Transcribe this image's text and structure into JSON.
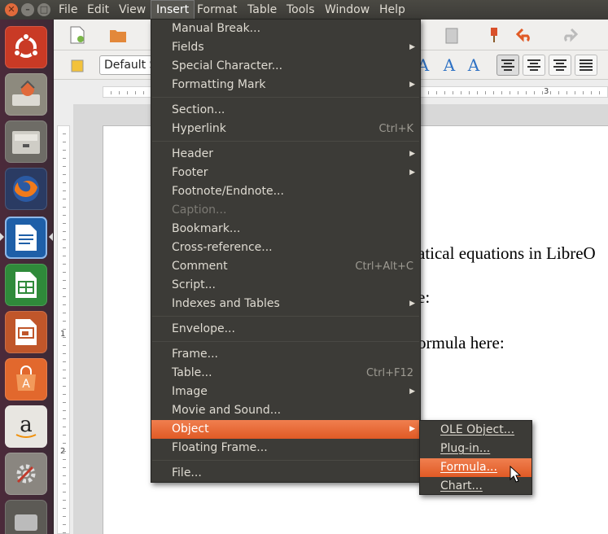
{
  "window_buttons": {
    "close": "✕",
    "minimize": "–",
    "maximize": "□"
  },
  "menubar": [
    "File",
    "Edit",
    "View",
    "Insert",
    "Format",
    "Table",
    "Tools",
    "Window",
    "Help"
  ],
  "style_box": "Default Style",
  "ruler": {
    "mark_h": "3",
    "mark_v1": "1",
    "mark_v2": "2"
  },
  "document": {
    "line1": "atical equations in LibreO",
    "line2": "e:",
    "line3": "ormula here:"
  },
  "insert_menu": {
    "items": [
      {
        "label": "Manual Break...",
        "submenu": false,
        "accel": ""
      },
      {
        "label": "Fields",
        "submenu": true,
        "accel": ""
      },
      {
        "label": "Special Character...",
        "submenu": false,
        "accel": ""
      },
      {
        "label": "Formatting Mark",
        "submenu": true,
        "accel": ""
      },
      {
        "label": "Section...",
        "submenu": false,
        "accel": ""
      },
      {
        "label": "Hyperlink",
        "submenu": false,
        "accel": "Ctrl+K"
      },
      {
        "label": "Header",
        "submenu": true,
        "accel": ""
      },
      {
        "label": "Footer",
        "submenu": true,
        "accel": ""
      },
      {
        "label": "Footnote/Endnote...",
        "submenu": false,
        "accel": ""
      },
      {
        "label": "Caption...",
        "submenu": false,
        "accel": "",
        "disabled": true
      },
      {
        "label": "Bookmark...",
        "submenu": false,
        "accel": ""
      },
      {
        "label": "Cross-reference...",
        "submenu": false,
        "accel": ""
      },
      {
        "label": "Comment",
        "submenu": false,
        "accel": "Ctrl+Alt+C"
      },
      {
        "label": "Script...",
        "submenu": false,
        "accel": ""
      },
      {
        "label": "Indexes and Tables",
        "submenu": true,
        "accel": ""
      },
      {
        "label": "Envelope...",
        "submenu": false,
        "accel": ""
      },
      {
        "label": "Frame...",
        "submenu": false,
        "accel": ""
      },
      {
        "label": "Table...",
        "submenu": false,
        "accel": "Ctrl+F12"
      },
      {
        "label": "Image",
        "submenu": true,
        "accel": ""
      },
      {
        "label": "Movie and Sound...",
        "submenu": false,
        "accel": ""
      },
      {
        "label": "Object",
        "submenu": true,
        "accel": "",
        "highlighted": true
      },
      {
        "label": "Floating Frame...",
        "submenu": false,
        "accel": ""
      },
      {
        "label": "File...",
        "submenu": false,
        "accel": ""
      }
    ]
  },
  "object_submenu": {
    "items": [
      {
        "label": "OLE Object...",
        "highlighted": false
      },
      {
        "label": "Plug-in...",
        "highlighted": false
      },
      {
        "label": "Formula...",
        "highlighted": true
      },
      {
        "label": "Chart...",
        "highlighted": false
      }
    ]
  },
  "colors": {
    "highlight": "#e65c27",
    "menu_bg": "#3c3b37",
    "launcher_bg": "#4b2a3a"
  },
  "icons": {
    "launcher": [
      "ubuntu-dash-icon",
      "system-installer-icon",
      "files-icon",
      "firefox-icon",
      "writer-icon",
      "calc-icon",
      "impress-icon",
      "software-center-icon",
      "amazon-icon",
      "system-settings-icon"
    ]
  }
}
